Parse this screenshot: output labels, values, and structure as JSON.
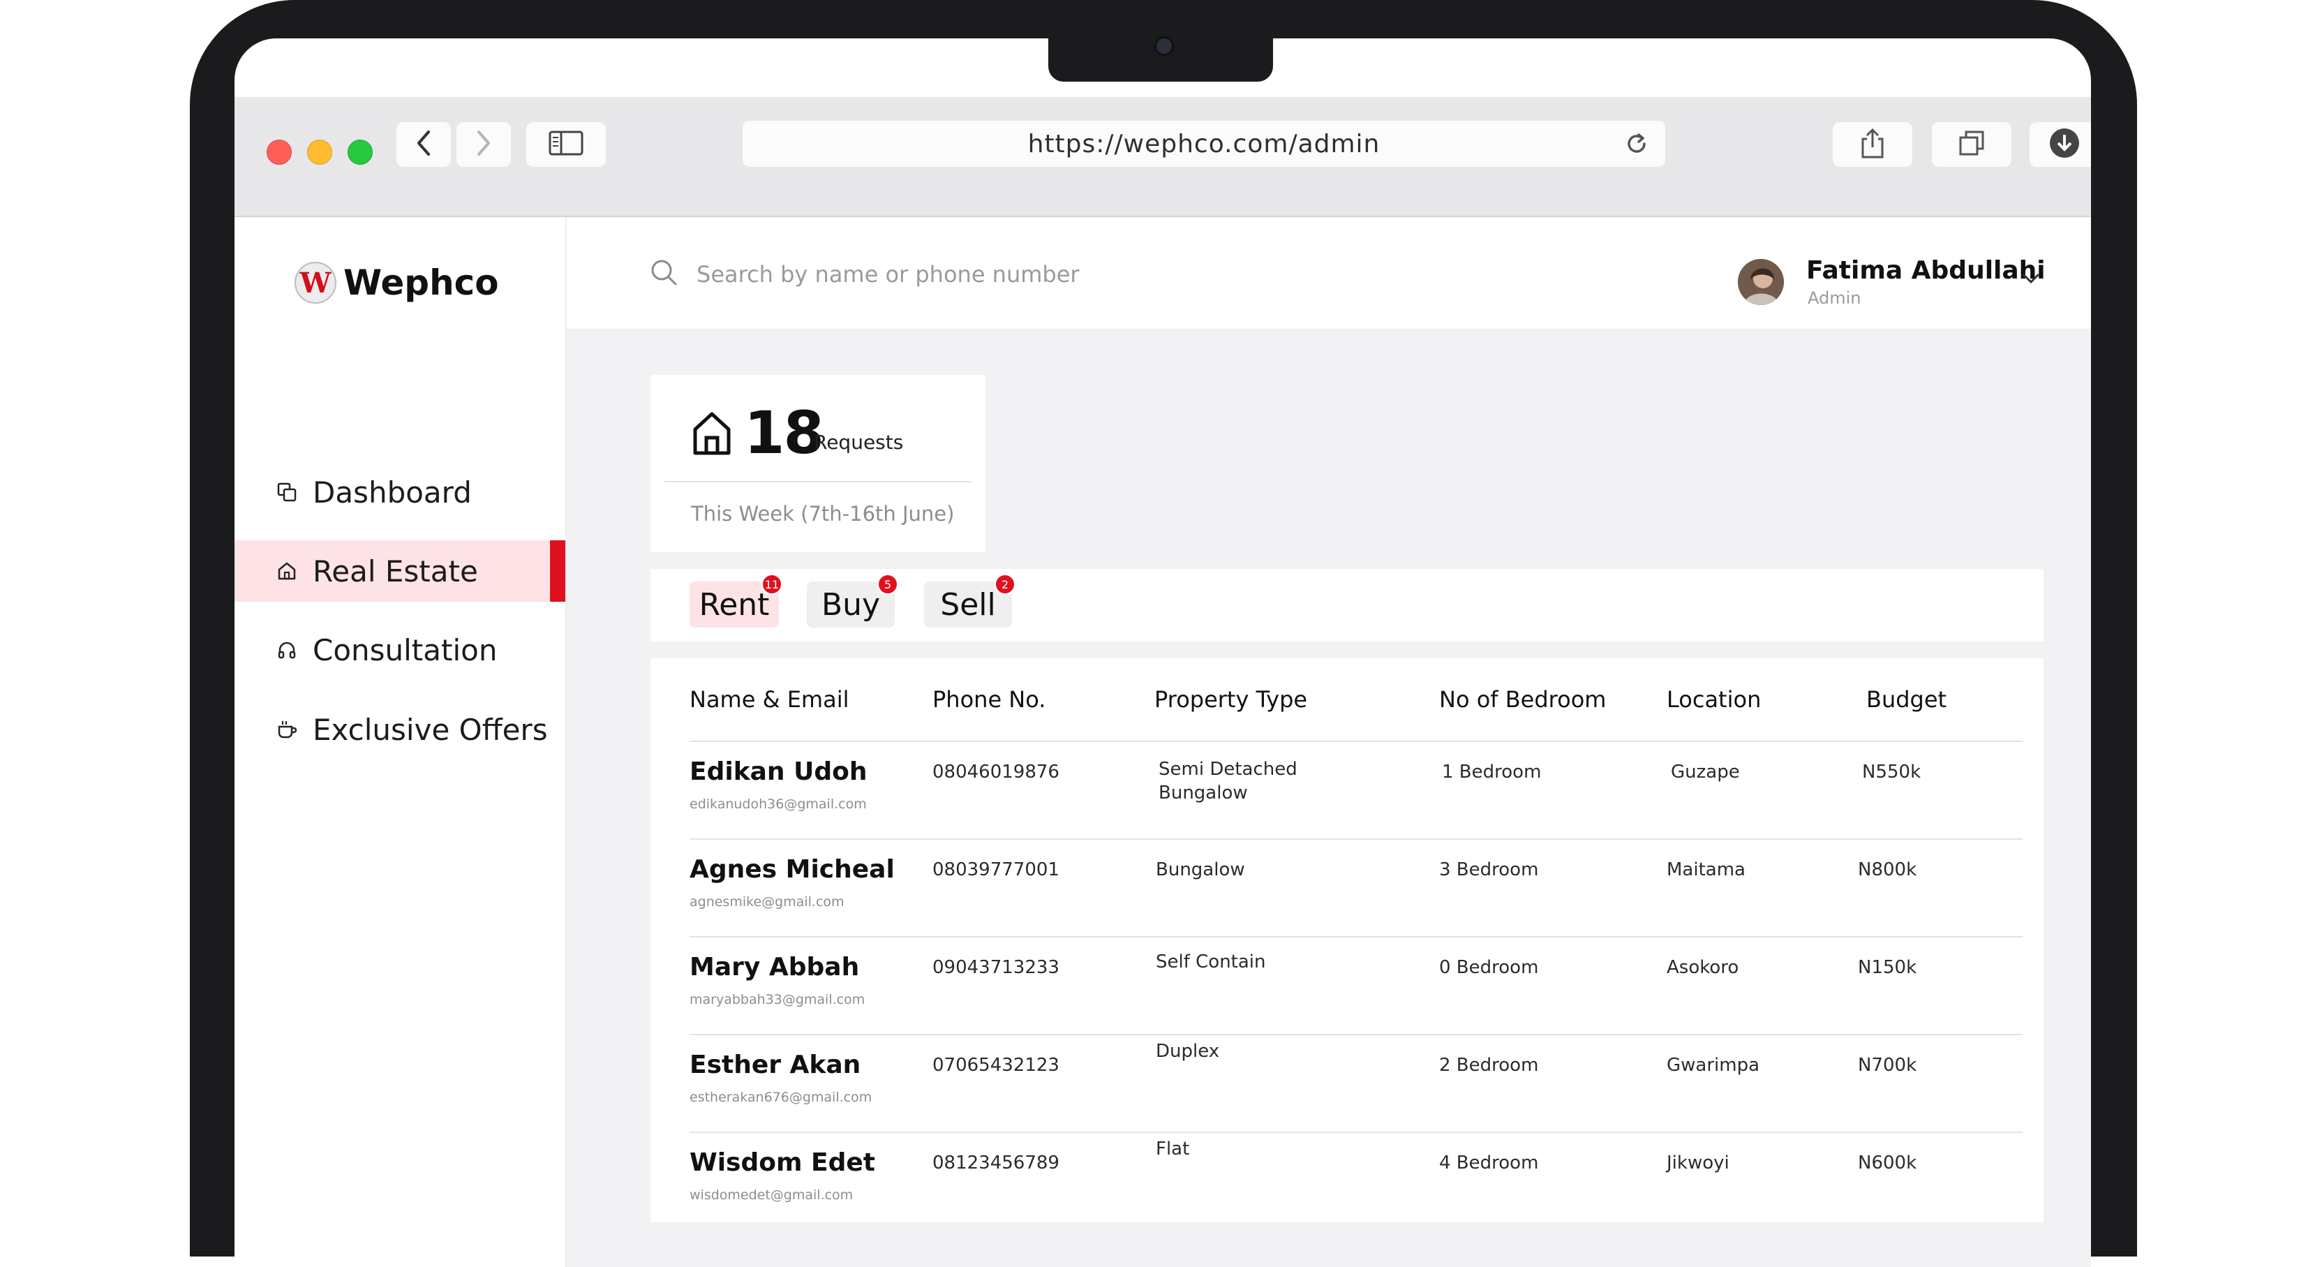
{
  "browser": {
    "url": "https://wephco.com/admin"
  },
  "brand": {
    "name": "Wephco",
    "logo_letter": "W",
    "accent": "#e0111f"
  },
  "sidebar": {
    "items": [
      {
        "label": "Dashboard",
        "icon": "copy-icon",
        "active": false
      },
      {
        "label": "Real Estate",
        "icon": "home-icon",
        "active": true
      },
      {
        "label": "Consultation",
        "icon": "headphones-icon",
        "active": false
      },
      {
        "label": "Exclusive Offers",
        "icon": "cup-icon",
        "active": false
      }
    ]
  },
  "header": {
    "search_placeholder": "Search by name or phone number",
    "user_name": "Fatima Abdullahi",
    "user_role": "Admin"
  },
  "stats": {
    "count": "18",
    "count_label": "Requests",
    "period": "This Week (7th-16th June)"
  },
  "tabs": [
    {
      "label": "Rent",
      "badge": "11",
      "active": true
    },
    {
      "label": "Buy",
      "badge": "5",
      "active": false
    },
    {
      "label": "Sell",
      "badge": "2",
      "active": false
    }
  ],
  "table": {
    "columns": [
      "Name & Email",
      "Phone No.",
      "Property Type",
      "No of Bedroom",
      "Location",
      "Budget"
    ],
    "rows": [
      {
        "name": "Edikan Udoh",
        "email": "edikanudoh36@gmail.com",
        "phone": "08046019876",
        "property_type": "Semi Detached\nBungalow",
        "bedrooms": "1 Bedroom",
        "location": "Guzape",
        "budget": "N550k"
      },
      {
        "name": "Agnes Micheal",
        "email": "agnesmike@gmail.com",
        "phone": "08039777001",
        "property_type": "Bungalow",
        "bedrooms": "3 Bedroom",
        "location": "Maitama",
        "budget": "N800k"
      },
      {
        "name": "Mary Abbah",
        "email": "maryabbah33@gmail.com",
        "phone": "09043713233",
        "property_type": "Self Contain",
        "bedrooms": "0 Bedroom",
        "location": "Asokoro",
        "budget": "N150k"
      },
      {
        "name": "Esther Akan",
        "email": "estherakan676@gmail.com",
        "phone": "07065432123",
        "property_type": "Duplex",
        "bedrooms": "2 Bedroom",
        "location": "Gwarimpa",
        "budget": "N700k"
      },
      {
        "name": "Wisdom Edet",
        "email": "wisdomedet@gmail.com",
        "phone": "08123456789",
        "property_type": "Flat",
        "bedrooms": "4 Bedroom",
        "location": "Jikwoyi",
        "budget": "N600k"
      }
    ]
  }
}
